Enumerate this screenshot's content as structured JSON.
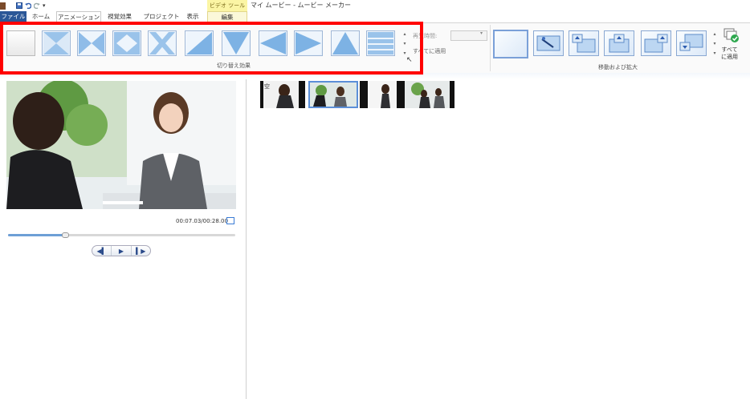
{
  "app": {
    "title": "マイ ムービー - ムービー メーカー",
    "context_tab_group": "ビデオ ツール"
  },
  "tabs": [
    {
      "label": "ファイル"
    },
    {
      "label": "ホーム"
    },
    {
      "label": "アニメーション"
    },
    {
      "label": "視覚効果"
    },
    {
      "label": "プロジェクト"
    },
    {
      "label": "表示"
    },
    {
      "label": "編集"
    }
  ],
  "ribbon": {
    "transitions_group_label": "切り替え効果",
    "duration_label": "再生時間:",
    "duration_value": "",
    "apply_all_label": "すべてに適用",
    "pan_zoom_group_label": "移動および拡大",
    "pan_zoom_apply_all_label": "すべて\nに適用",
    "transitions": [
      {
        "icon": "no-transition-icon"
      },
      {
        "icon": "cross-fade-diagonal-icon"
      },
      {
        "icon": "wipe-hourglass-icon"
      },
      {
        "icon": "diamond-icon"
      },
      {
        "icon": "cross-zoom-icon"
      },
      {
        "icon": "diagonal-wipe-icon"
      },
      {
        "icon": "triangle-down-icon"
      },
      {
        "icon": "arrow-left-icon"
      },
      {
        "icon": "arrow-right-icon"
      },
      {
        "icon": "triangle-up-icon"
      },
      {
        "icon": "bars-icon"
      }
    ],
    "pan_zoom": [
      {
        "icon": "no-pan-zoom-icon"
      },
      {
        "icon": "auto-pan-zoom-icon"
      },
      {
        "icon": "pan-up-left-icon"
      },
      {
        "icon": "pan-up-icon"
      },
      {
        "icon": "pan-up-right-icon"
      },
      {
        "icon": "pan-down-left-icon"
      }
    ]
  },
  "preview": {
    "timecode": "00:07.03/00:28.00",
    "seek_progress": 0.25
  },
  "storyboard": {
    "marker_text": "空"
  },
  "colors": {
    "accent": "#2b5797",
    "highlight_frame": "#ff0000",
    "context_tab": "#fbf5a4",
    "seek_fill": "#6d9fd6"
  }
}
